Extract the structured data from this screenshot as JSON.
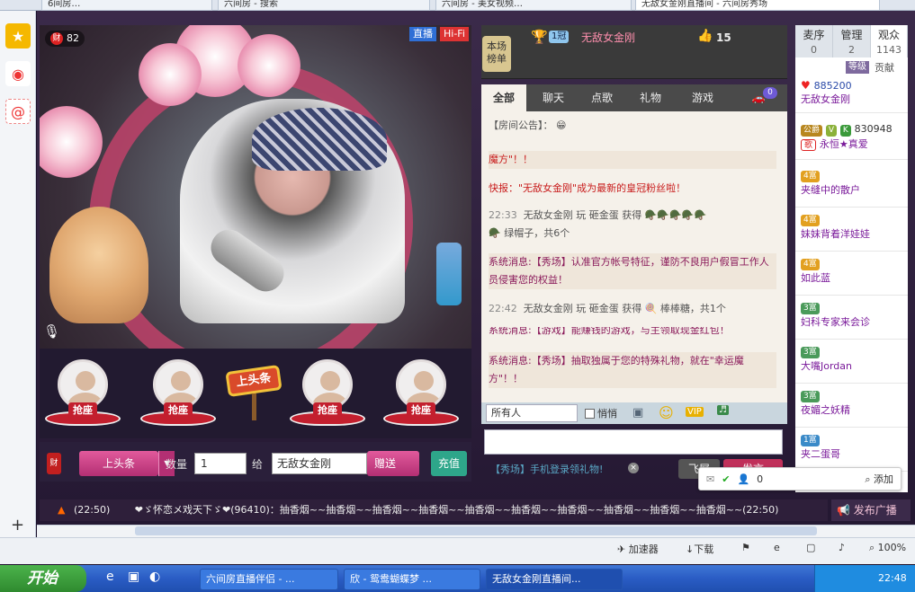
{
  "browser": {
    "tabs": [
      {
        "label": "6间房…"
      },
      {
        "label": "六间房 - 搜索"
      },
      {
        "label": "六间房 - 美女视频…"
      },
      {
        "label": "无敌女金刚直播间 - 六间房秀场"
      }
    ]
  },
  "leftbar": {
    "icons": [
      "star-icon",
      "weibo-icon",
      "mail-icon"
    ],
    "add_label": "+"
  },
  "video": {
    "money_count": "82",
    "money_icon": "财",
    "live_label": "直播",
    "hifi_label": "Hi-Fi"
  },
  "seats": {
    "seat_label": "抢座",
    "banner_label": "上头条"
  },
  "controls": {
    "redbag_label": "财",
    "gift_label": "上头条",
    "qty_label": "数量",
    "qty_value": "1",
    "to_label": "给",
    "to_value": "无敌女金刚",
    "send_label": "赠送",
    "recharge_label": "充值"
  },
  "roomhead": {
    "board_label": "本场榜单",
    "host_level": "1冠",
    "host_name": "无敌女金刚",
    "fan_count": "15"
  },
  "chat_tabs": [
    {
      "label": "全部",
      "active": true
    },
    {
      "label": "聊天",
      "active": false
    },
    {
      "label": "点歌",
      "active": false
    },
    {
      "label": "礼物",
      "active": false
    },
    {
      "label": "游戏",
      "active": false
    }
  ],
  "car_badge": "0",
  "chat": {
    "announcement": "【房间公告】：",
    "magic_line": "魔方\"！！",
    "news_line": "快报：\"无敌女金刚\"成为最新的皇冠粉丝啦！",
    "game1_time": "22:33",
    "game1_text": "无敌女金刚 玩 砸金蛋 获得",
    "game1_result": "绿帽子，共6个",
    "sys1": "系统消息:【秀场】认准官方帐号特征，谨防不良用户假冒工作人员侵害您的权益！",
    "game2_time": "22:42",
    "game2_text": "无敌女金刚 玩 砸金蛋 获得",
    "game2_result": "棒棒糖，共1个",
    "sys_partial": "系统消息:【游戏】能赚钱的游戏，与主领取现金红包！",
    "sys2": "系统消息:【秀场】抽取独属于您的特殊礼物，就在\"幸运魔方\"！！"
  },
  "chat_toolbar": {
    "audience": "所有人",
    "whisper": "悄悄"
  },
  "chat_bottom": {
    "promo": "【秀场】手机登录领礼物!",
    "fly_label": "飞屏",
    "send_label": "发言"
  },
  "right_panel": {
    "tabs": [
      {
        "label": "麦序",
        "count": "0"
      },
      {
        "label": "管理",
        "count": "2"
      },
      {
        "label": "观众",
        "count": "1143"
      }
    ],
    "level_label": "等级",
    "contrib_label": "贡献",
    "top_score": "885200",
    "top_name": "无敌女金刚",
    "vip_level": "公爵",
    "vip_score": "830948",
    "vip_name": "永恒★真爱",
    "vip_tag": "歌",
    "users": [
      {
        "badge": "4富",
        "name": "夹缝中的散户"
      },
      {
        "badge": "4富",
        "name": "妹妹背着洋娃娃"
      },
      {
        "badge": "4富",
        "name": "如此蓝"
      },
      {
        "badge": "3富",
        "name": "妇科专家来会诊"
      },
      {
        "badge": "3富",
        "name": "大嘴Jordan"
      },
      {
        "badge": "3富",
        "name": "夜媚之妖精"
      },
      {
        "badge": "1富",
        "name": "夹二蛋哥"
      }
    ]
  },
  "popup": {
    "count": "0",
    "add_label": "添加"
  },
  "marquee": {
    "time": "(22:50)",
    "text": "❤ゞ怀恋メ戏天下ゞ❤(96410)：抽香烟~~抽香烟~~抽香烟~~抽香烟~~抽香烟~~抽香烟~~抽香烟~~抽香烟~~抽香烟~~抽香烟~~(22:50)",
    "broadcast_label": "发布广播"
  },
  "statusbar": {
    "accelerator": "加速器",
    "download": "下载",
    "zoom": "100%"
  },
  "taskbar": {
    "start_label": "开始",
    "tasks": [
      {
        "label": "六间房直播伴侣 - ..."
      },
      {
        "label": "欣 - 鸳鸯蝴蝶梦 ..."
      },
      {
        "label": "无敌女金刚直播间..."
      }
    ],
    "clock": "22:48"
  },
  "colors": {
    "accent_pink": "#c0305a",
    "chat_bg": "#f5f1ea",
    "taskbar_blue": "#2a5cc4"
  }
}
